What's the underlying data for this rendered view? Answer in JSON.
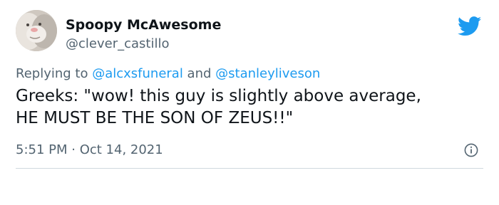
{
  "author": {
    "display_name": "Spoopy McAwesome",
    "handle": "@clever_castillo",
    "avatar_icon": "cat-avatar"
  },
  "brand_icon": "twitter-bird-icon",
  "brand_color": "#1d9bf0",
  "reply_context": {
    "prefix": "Replying to ",
    "mention_1": "@alcxsfuneral",
    "conjunction": " and ",
    "mention_2": "@stanleyliveson"
  },
  "tweet_text": {
    "line_1": "Greeks: \"wow! this guy is slightly above average,",
    "line_2": "HE MUST BE THE SON OF ZEUS!!\""
  },
  "timestamp": "5:51 PM · Oct 14, 2021",
  "info_icon": "info-icon"
}
